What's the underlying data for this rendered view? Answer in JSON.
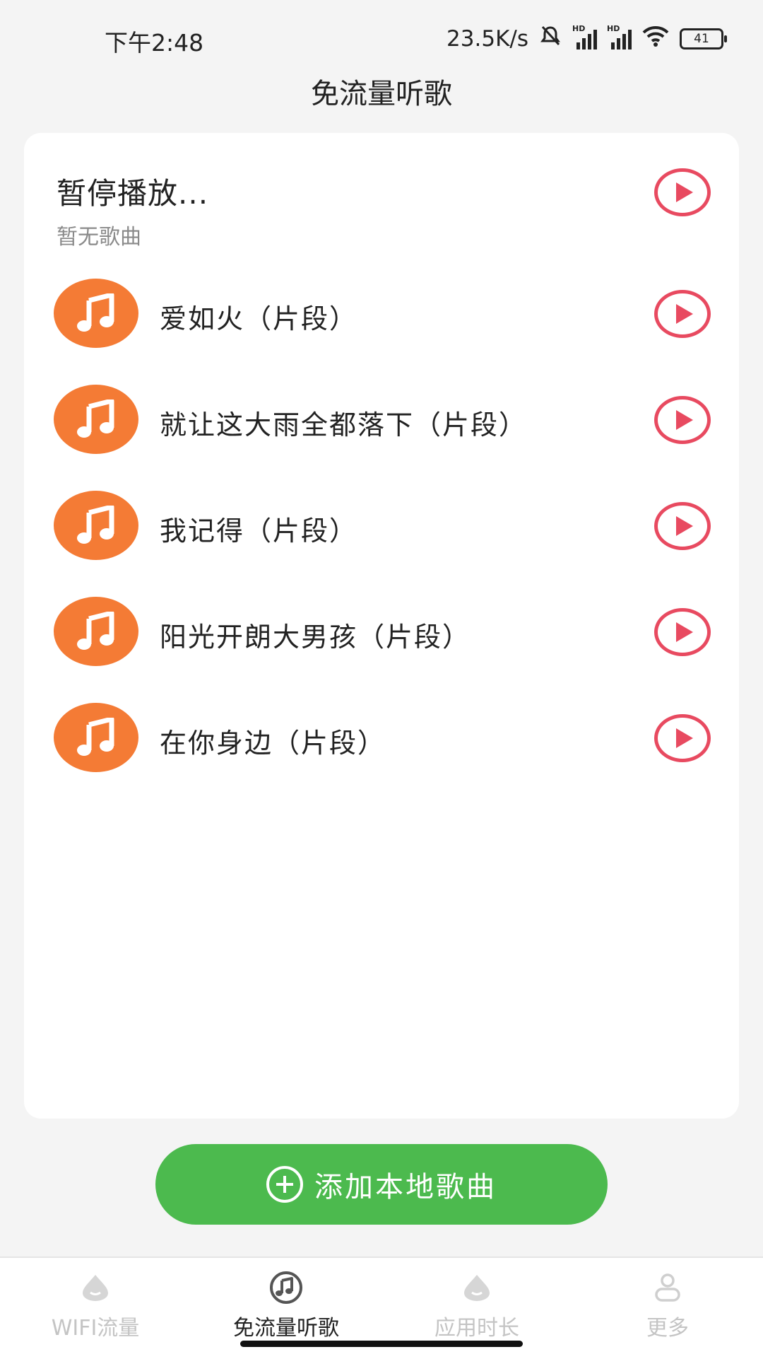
{
  "status_bar": {
    "time": "下午2:48",
    "net_speed": "23.5K/s",
    "battery": "41"
  },
  "header": {
    "title": "免流量听歌"
  },
  "now_playing": {
    "status": "暂停播放...",
    "subtitle": "暂无歌曲",
    "play_icon": "play-circle-icon"
  },
  "songs": [
    {
      "title": "爱如火（片段）"
    },
    {
      "title": "就让这大雨全都落下（片段）"
    },
    {
      "title": "我记得（片段）"
    },
    {
      "title": "阳光开朗大男孩（片段）"
    },
    {
      "title": "在你身边（片段）"
    }
  ],
  "add_button": {
    "label": "添加本地歌曲"
  },
  "tabs": [
    {
      "label": "WIFI流量",
      "active": false,
      "icon": "drop-icon"
    },
    {
      "label": "免流量听歌",
      "active": true,
      "icon": "music-note-icon"
    },
    {
      "label": "应用时长",
      "active": false,
      "icon": "drop-icon"
    },
    {
      "label": "更多",
      "active": false,
      "icon": "person-icon"
    }
  ],
  "colors": {
    "accent_red": "#e84a60",
    "song_icon_orange": "#f47b35",
    "button_green": "#4cba4e",
    "background": "#f4f4f4"
  }
}
